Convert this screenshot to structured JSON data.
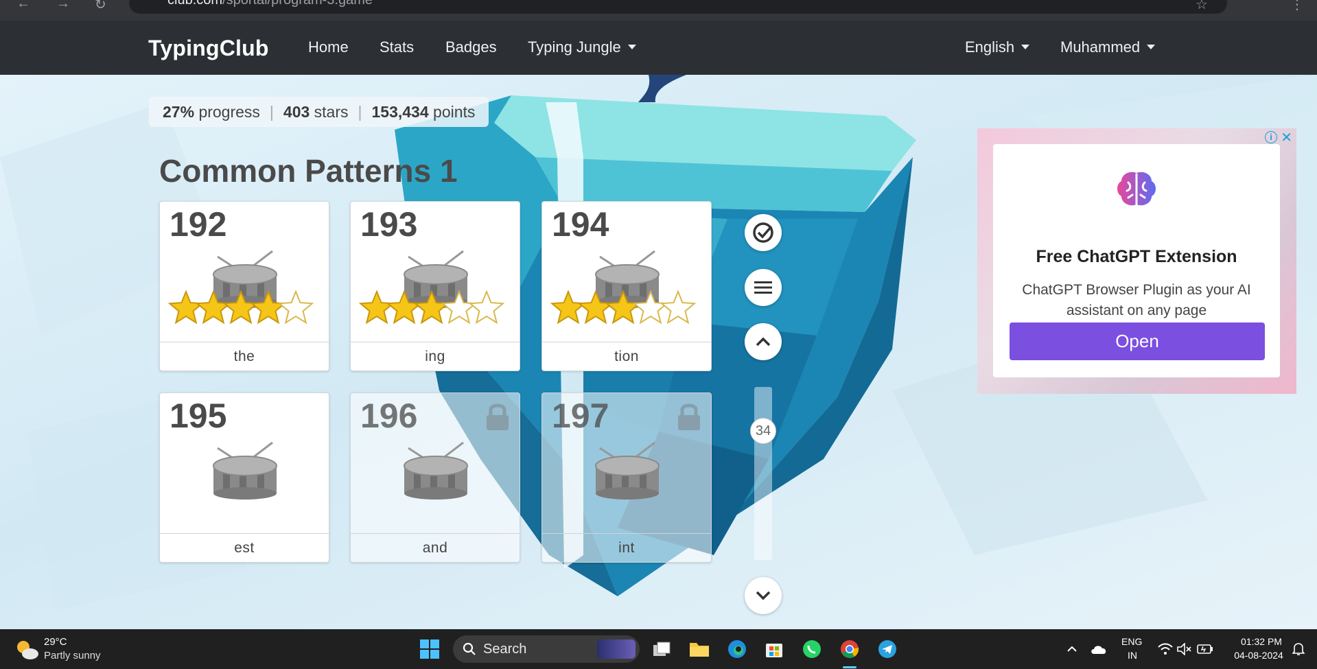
{
  "browser": {
    "url_host": "club.com",
    "url_path": "/sportal/program-3.game"
  },
  "navbar": {
    "brand": "TypingClub",
    "links": [
      "Home",
      "Stats",
      "Badges",
      "Typing Jungle"
    ],
    "language": "English",
    "user": "Muhammed"
  },
  "progress": {
    "percent": "27%",
    "percent_label": "progress",
    "stars": "403",
    "stars_label": "stars",
    "points": "153,434",
    "points_label": "points"
  },
  "section_title": "Common Patterns 1",
  "lessons": [
    {
      "num": "192",
      "word": "the",
      "stars": 4,
      "locked": false
    },
    {
      "num": "193",
      "word": "ing",
      "stars": 3,
      "locked": false
    },
    {
      "num": "194",
      "word": "tion",
      "stars": 3,
      "locked": false
    },
    {
      "num": "195",
      "word": "est",
      "stars": 0,
      "locked": false
    },
    {
      "num": "196",
      "word": "and",
      "stars": 0,
      "locked": true
    },
    {
      "num": "197",
      "word": "int",
      "stars": 0,
      "locked": true
    }
  ],
  "scroller": {
    "position_label": "34"
  },
  "ad": {
    "title": "Free ChatGPT Extension",
    "body": "ChatGPT Browser Plugin as your AI assistant on any page",
    "button": "Open"
  },
  "taskbar": {
    "temperature": "29°C",
    "weather": "Partly sunny",
    "search_placeholder": "Search",
    "lang_top": "ENG",
    "lang_bottom": "IN",
    "time": "01:32 PM",
    "date": "04-08-2024"
  },
  "colors": {
    "navbar": "#2c3035",
    "ad_button": "#7b4fe0",
    "star": "#f5c518",
    "ice": "#1b86b3"
  }
}
